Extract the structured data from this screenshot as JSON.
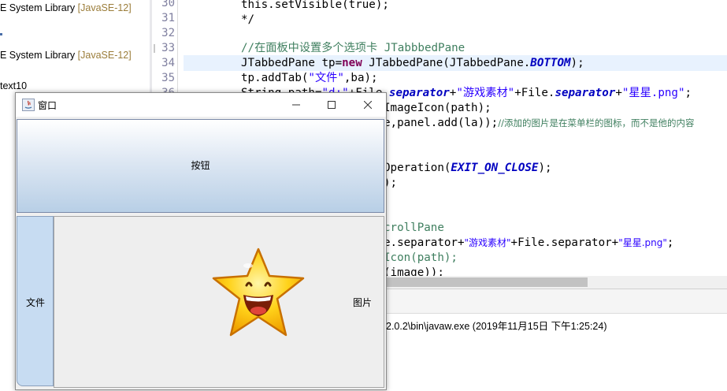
{
  "package_explorer": {
    "rows": [
      {
        "text": "E System Library ",
        "suffix": "[JavaSE-12]"
      },
      {
        "text": "E System Library ",
        "suffix": "[JavaSE-12]"
      },
      {
        "text": "text10",
        "suffix": ""
      }
    ]
  },
  "editor": {
    "line_numbers": [
      "30",
      "31",
      "32",
      "33",
      "34",
      "35",
      "36"
    ],
    "lines": {
      "l30": "this.setVisible(true);",
      "l31": "*/",
      "l33": "//在面板中设置多个选项卡 JTabbbedPane",
      "l34_a": "JTabbedPane tp=",
      "l34_kw": "new",
      "l34_b": " JTabbedPane(JTabbedPane.",
      "l34_fld": "BOTTOM",
      "l34_c": ");",
      "l35_a": "tp.addTab(",
      "l35_str": "\"文件\"",
      "l35_b": ",ba);",
      "l36_a": "String path=",
      "l36_str1": "\"d:\"",
      "l36_b": "+File.",
      "l36_fld1": "separator",
      "l36_c": "+",
      "l36_str2": "\"游戏素材\"",
      "l36_d": "+File.",
      "l36_fld2": "separator",
      "l36_e": "+",
      "l36_str3": "\"星星.png\"",
      "l36_f": ";",
      "l37": "ImageIcon(path);",
      "l38_a": "e,panel.add(la));",
      "l38_cm": "//添加的图片是在菜单栏的图标，而不是他的内容",
      "l40_a": "Operation(",
      "l40_fld": "EXIT_ON_CLOSE",
      "l40_b": ");",
      "l41": ");",
      "l44": "crollPane",
      "l45_a": "e.separator+",
      "l45_str1": "\"游戏素材\"",
      "l45_b": "+File.separator+",
      "l45_str2": "\"星星.png\"",
      "l45_c": ";",
      "l46": "Icon(path);",
      "l47": "(image));"
    }
  },
  "console": {
    "text": "2.0.2\\bin\\javaw.exe (2019年11月15日 下午1:25:24)"
  },
  "window": {
    "title": "窗口",
    "button_label": "按钮",
    "tabs": [
      {
        "label": "文件"
      },
      {
        "label": "图片"
      }
    ]
  },
  "colors": {
    "keyword": "#7f0055",
    "comment": "#3f7f5f",
    "string": "#2a00ff",
    "field": "#0000c0",
    "button_gradient_bottom": "#b8cfe6",
    "tab_selected": "#c7dcf2"
  }
}
